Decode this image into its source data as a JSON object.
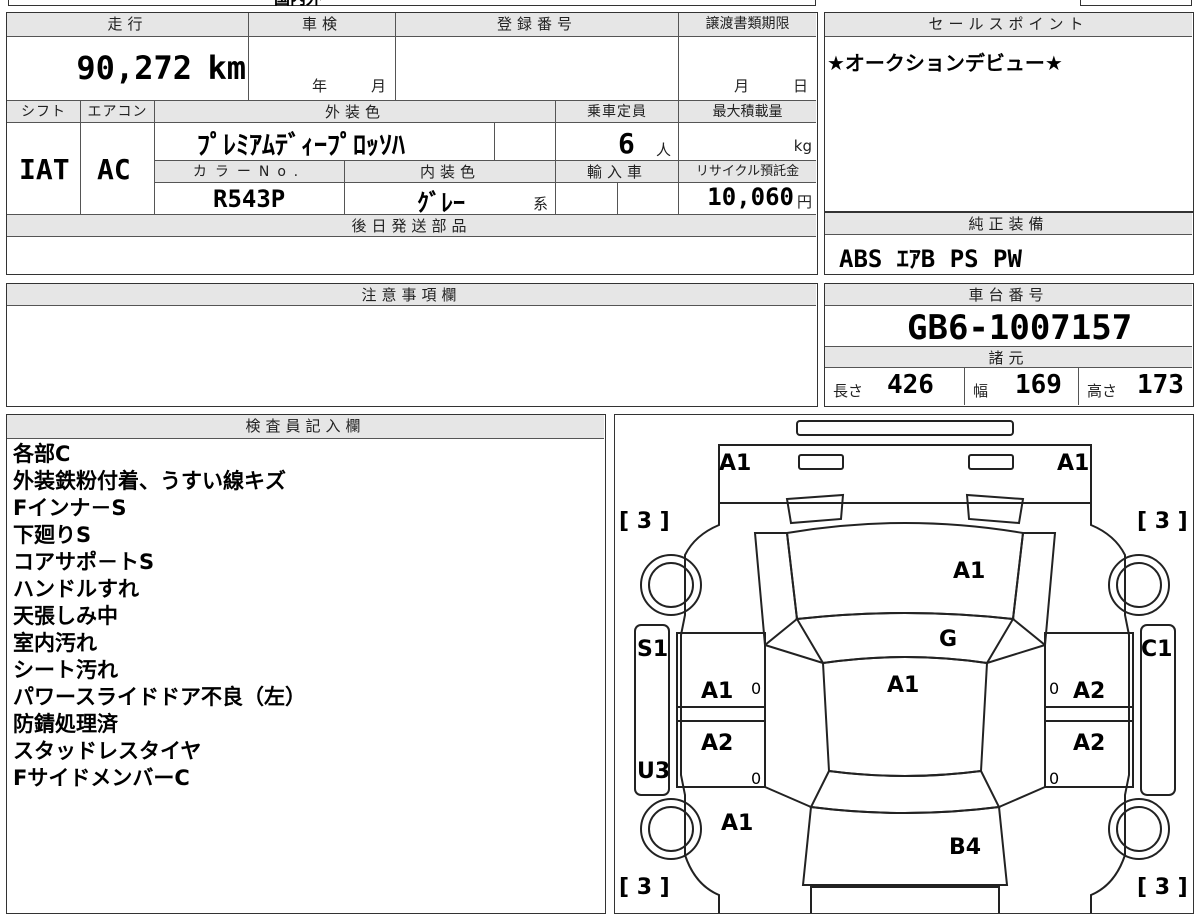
{
  "top_strip": {
    "cut_text": "国內外"
  },
  "vehicle": {
    "mileage_label": "走行",
    "mileage": "90,272",
    "mileage_unit": "km",
    "inspection_label": "車検",
    "inspection_year_unit": "年",
    "inspection_month_unit": "月",
    "reg_no_label": "登録番号",
    "transfer_label": "譲渡書類期限",
    "transfer_month_unit": "月",
    "transfer_day_unit": "日",
    "shift_label": "シフト",
    "shift": "IAT",
    "ac_label": "エアコン",
    "ac": "AC",
    "ext_color_label": "外装色",
    "ext_color": "プレミアムディープロッソP",
    "ext_color_display": "ﾌﾟﾚﾐｱﾑﾃﾞｨｰﾌﾟﾛｯｿﾊ",
    "capacity_label": "乗車定員",
    "capacity": "6",
    "capacity_unit": "人",
    "max_load_label": "最大積載量",
    "max_load_unit": "kg",
    "color_no_label": "カラーNo.",
    "color_no": "R543P",
    "int_color_label": "内装色",
    "int_color": "ｸﾞﾚｰ",
    "int_color_suffix": "系",
    "import_label": "輸入車",
    "recycle_label": "リサイクル預託金",
    "recycle_fee": "10,060",
    "recycle_unit": "円",
    "later_parts_label": "後日発送部品"
  },
  "sales": {
    "label": "セールスポイント",
    "text": "★オークションデビュー★"
  },
  "equipment": {
    "label": "純正装備",
    "text": "ABS ｴｱB PS PW"
  },
  "caution": {
    "label": "注意事項欄"
  },
  "chassis": {
    "label": "車台番号",
    "number": "GB6-1007157"
  },
  "specs": {
    "label": "諸元",
    "length_label": "長さ",
    "length": "426",
    "width_label": "幅",
    "width": "169",
    "height_label": "高さ",
    "height": "173"
  },
  "inspector": {
    "label": "検査員記入欄",
    "notes": [
      "各部C",
      "外装鉄粉付着、うすい線キズ",
      "Fインナ－S",
      "下廻りS",
      "コアサポ－トS",
      "ハンドルすれ",
      "天張しみ中",
      "室内汚れ",
      "シート汚れ",
      "パワースライドドア不良（左）",
      "防錆処理済",
      "スタッドレスタイヤ",
      "FサイドメンバーC"
    ]
  },
  "diagram": {
    "marks": {
      "front_left": "A1",
      "front_right": "A1",
      "hood": "A1",
      "windshield": "G",
      "roof": "A1",
      "left_front_door": "A1",
      "left_rear_door": "A2",
      "right_front_door": "A2",
      "right_rear_door": "A2",
      "left_sill_top": "S1",
      "left_sill_bottom": "U3",
      "right_sill": "C1",
      "rear_left": "A1",
      "rear_center": "B4",
      "tire_fl": "[ 3 ]",
      "tire_fr": "[ 3 ]",
      "tire_rl": "[ 3 ]",
      "tire_rr": "[ 3 ]",
      "zero": "0"
    }
  }
}
